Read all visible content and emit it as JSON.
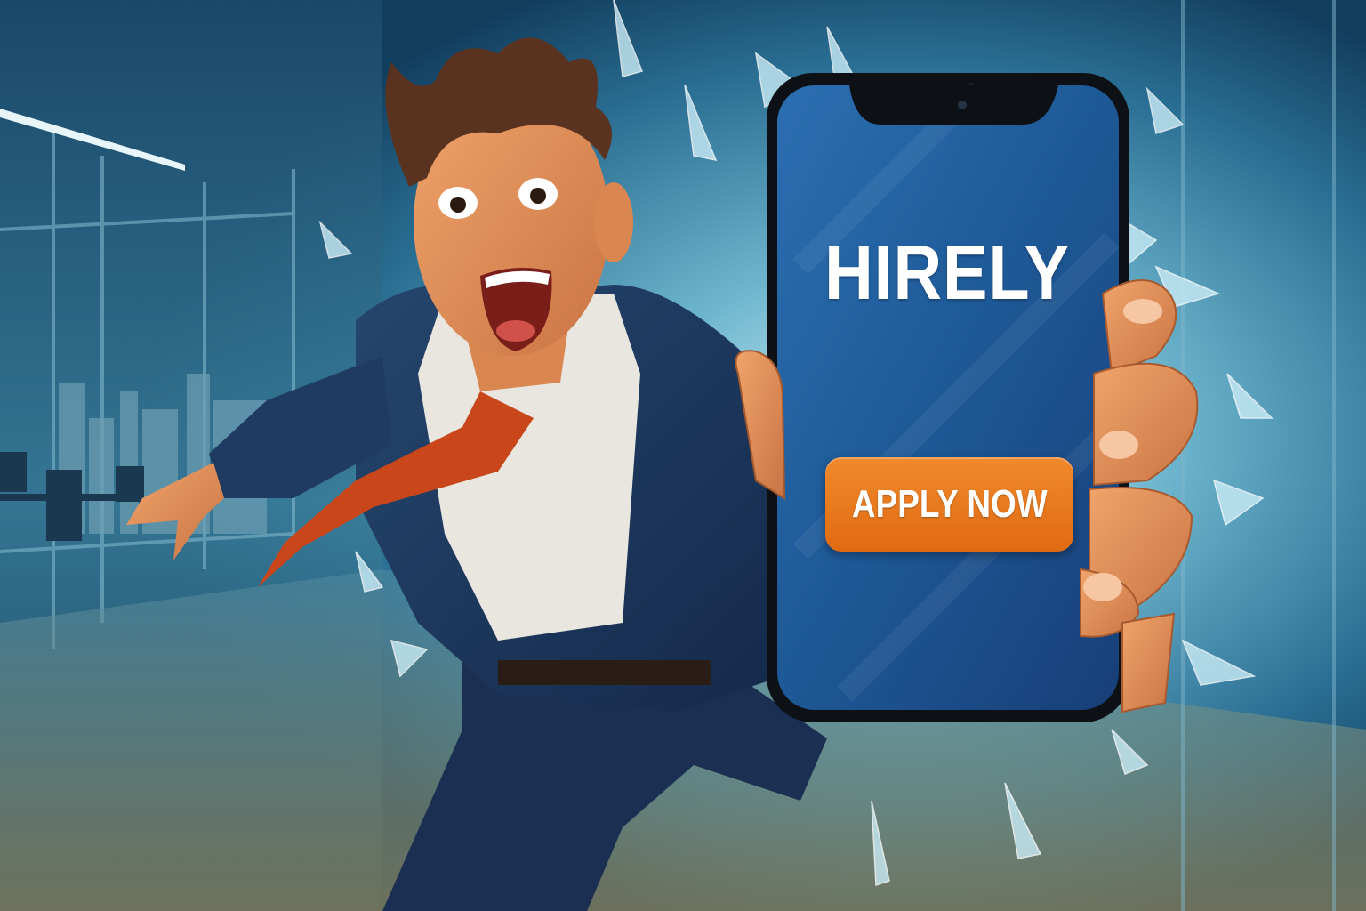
{
  "phone_app": {
    "brand": "HIRELY",
    "cta_label": "APPLY NOW"
  },
  "colors": {
    "background_blue": "#1f5f86",
    "screen_blue": "#1d5a9a",
    "cta_orange": "#e8761c",
    "suit_navy": "#1c3558",
    "tie_orange": "#c9461a",
    "skin": "#e3945c",
    "hair": "#5a3320"
  },
  "icons": [
    "glass-shard-icon"
  ]
}
